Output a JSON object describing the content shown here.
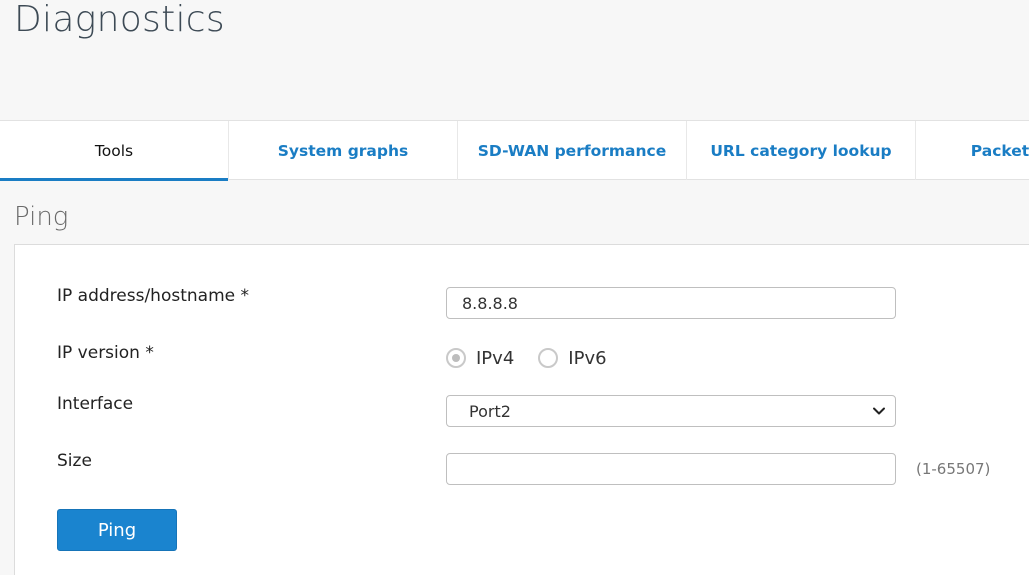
{
  "page": {
    "title": "Diagnostics"
  },
  "tabs": [
    {
      "label": "Tools",
      "active": true
    },
    {
      "label": "System graphs",
      "active": false
    },
    {
      "label": "SD-WAN performance",
      "active": false
    },
    {
      "label": "URL category lookup",
      "active": false
    },
    {
      "label": "Packet",
      "active": false
    }
  ],
  "ping": {
    "section_title": "Ping",
    "ip_label": "IP address/hostname *",
    "ip_value": "8.8.8.8",
    "ip_version_label": "IP version *",
    "ipv4_label": "IPv4",
    "ipv6_label": "IPv6",
    "ip_version_selected": "IPv4",
    "interface_label": "Interface",
    "interface_value": "Port2",
    "size_label": "Size",
    "size_value": "",
    "size_hint": "(1-65507)",
    "button_label": "Ping"
  },
  "colors": {
    "accent": "#1a84cf",
    "tab_link": "#1a7dc4",
    "background": "#f7f7f7"
  }
}
